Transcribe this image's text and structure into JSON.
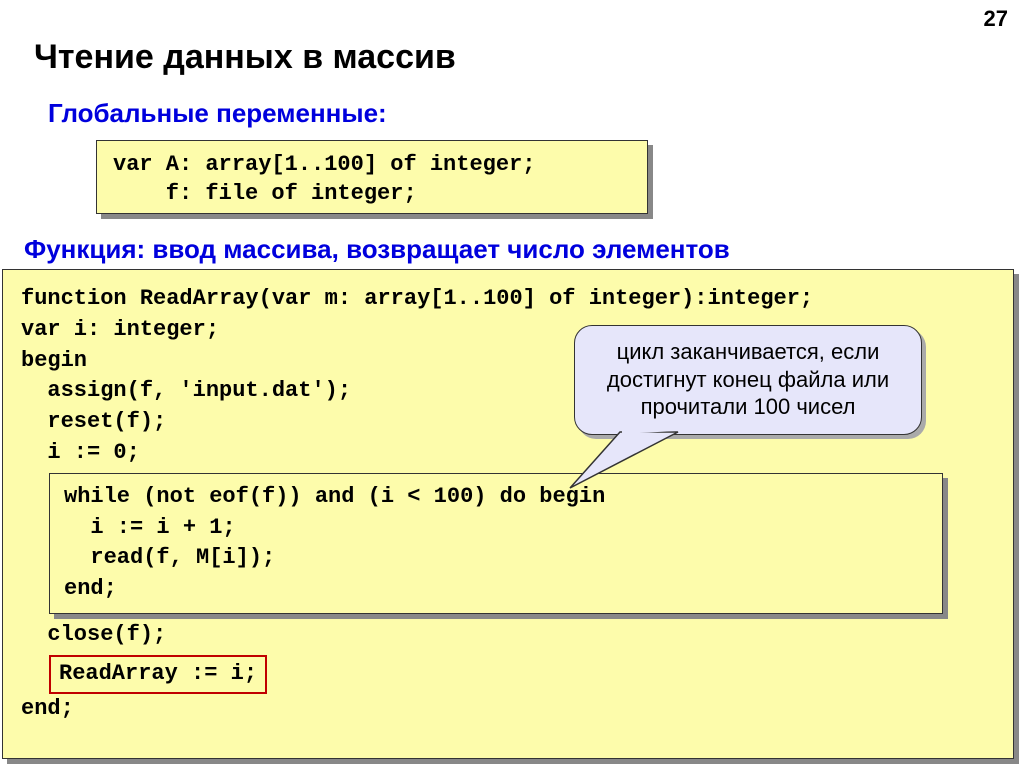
{
  "page_number": "27",
  "title": "Чтение данных в массив",
  "subtitle_globals": "Глобальные переменные:",
  "subtitle_function": "Функция: ввод массива, возвращает число элементов",
  "globals_code": "var A: array[1..100] of integer;\n    f: file of integer;",
  "main_code": {
    "l1": "function ReadArray(var m: array[1..100] of integer):integer;",
    "l2": "var i: integer;",
    "l3": "begin",
    "l4": "  assign(f, 'input.dat');",
    "l5": "  reset(f);",
    "l6": "  i := 0;",
    "l7": "  close(f);",
    "highlight": "ReadArray := i;",
    "l8": "end;"
  },
  "inner_code": {
    "l1": "while (not eof(f)) and (i < 100) do begin",
    "l2": "  i := i + 1;",
    "l3": "  read(f, M[i]);",
    "l4": "end;"
  },
  "callout_text": "цикл заканчивается, если достигнут конец файла или прочитали 100 чисел"
}
